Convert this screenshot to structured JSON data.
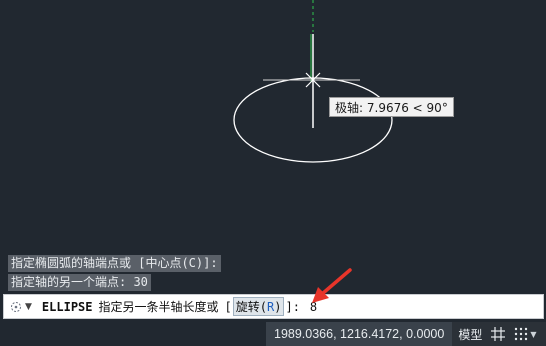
{
  "drawing": {
    "tooltip_label": "极轴",
    "tooltip_value": ": 7.9676 < 90°"
  },
  "command_history": [
    "指定椭圆弧的轴端点或 [中心点(C)]:",
    "指定轴的另一个端点: 30"
  ],
  "command_line": {
    "command": "ELLIPSE",
    "prompt": "指定另一条半轴长度或",
    "bracket_open": "[",
    "option_label": "旋转",
    "option_key_open": "(",
    "option_key": "R",
    "option_key_close": ")",
    "bracket_close": "]:",
    "input_value": "8"
  },
  "status_bar": {
    "coordinates": "1989.0366, 1216.4172, 0.0000",
    "space": "模型",
    "icons": [
      "grid-icon",
      "snap-dots-icon"
    ]
  },
  "colors": {
    "canvas_bg": "#212830",
    "annotation_arrow": "#e8352a",
    "polar_tracking_line": "#2ec24e"
  }
}
